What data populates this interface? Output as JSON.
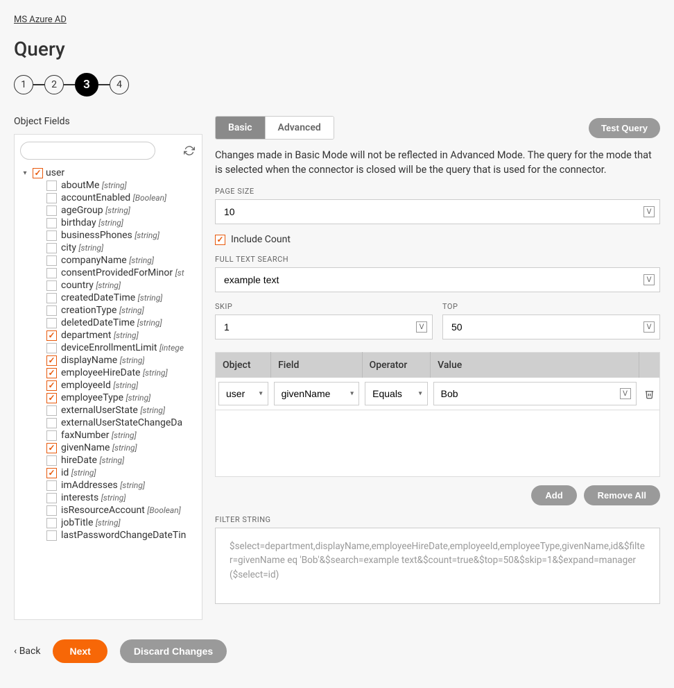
{
  "breadcrumb": "MS Azure AD",
  "page_title": "Query",
  "stepper": {
    "steps": [
      "1",
      "2",
      "3",
      "4"
    ],
    "active_index": 2
  },
  "left": {
    "title": "Object Fields",
    "search_placeholder": "",
    "root": {
      "label": "user",
      "checked": true,
      "expanded": true
    },
    "fields": [
      {
        "name": "aboutMe",
        "type": "[string]",
        "checked": false
      },
      {
        "name": "accountEnabled",
        "type": "[Boolean]",
        "checked": false
      },
      {
        "name": "ageGroup",
        "type": "[string]",
        "checked": false
      },
      {
        "name": "birthday",
        "type": "[string]",
        "checked": false
      },
      {
        "name": "businessPhones",
        "type": "[string]",
        "checked": false
      },
      {
        "name": "city",
        "type": "[string]",
        "checked": false
      },
      {
        "name": "companyName",
        "type": "[string]",
        "checked": false
      },
      {
        "name": "consentProvidedForMinor",
        "type": "[st",
        "checked": false
      },
      {
        "name": "country",
        "type": "[string]",
        "checked": false
      },
      {
        "name": "createdDateTime",
        "type": "[string]",
        "checked": false
      },
      {
        "name": "creationType",
        "type": "[string]",
        "checked": false
      },
      {
        "name": "deletedDateTime",
        "type": "[string]",
        "checked": false
      },
      {
        "name": "department",
        "type": "[string]",
        "checked": true
      },
      {
        "name": "deviceEnrollmentLimit",
        "type": "[intege",
        "checked": false
      },
      {
        "name": "displayName",
        "type": "[string]",
        "checked": true
      },
      {
        "name": "employeeHireDate",
        "type": "[string]",
        "checked": true
      },
      {
        "name": "employeeId",
        "type": "[string]",
        "checked": true
      },
      {
        "name": "employeeType",
        "type": "[string]",
        "checked": true
      },
      {
        "name": "externalUserState",
        "type": "[string]",
        "checked": false
      },
      {
        "name": "externalUserStateChangeDa",
        "type": "",
        "checked": false
      },
      {
        "name": "faxNumber",
        "type": "[string]",
        "checked": false
      },
      {
        "name": "givenName",
        "type": "[string]",
        "checked": true
      },
      {
        "name": "hireDate",
        "type": "[string]",
        "checked": false
      },
      {
        "name": "id",
        "type": "[string]",
        "checked": true
      },
      {
        "name": "imAddresses",
        "type": "[string]",
        "checked": false
      },
      {
        "name": "interests",
        "type": "[string]",
        "checked": false
      },
      {
        "name": "isResourceAccount",
        "type": "[Boolean]",
        "checked": false
      },
      {
        "name": "jobTitle",
        "type": "[string]",
        "checked": false
      },
      {
        "name": "lastPasswordChangeDateTin",
        "type": "",
        "checked": false
      }
    ]
  },
  "right": {
    "tabs": {
      "basic": "Basic",
      "advanced": "Advanced",
      "active": "basic"
    },
    "test_query": "Test Query",
    "info": "Changes made in Basic Mode will not be reflected in Advanced Mode. The query for the mode that is selected when the connector is closed will be the query that is used for the connector.",
    "page_size": {
      "label": "PAGE SIZE",
      "value": "10"
    },
    "include_count": {
      "label": "Include Count",
      "checked": true
    },
    "full_text": {
      "label": "FULL TEXT SEARCH",
      "value": "example text"
    },
    "skip": {
      "label": "SKIP",
      "value": "1"
    },
    "top": {
      "label": "TOP",
      "value": "50"
    },
    "filter_cols": {
      "object": "Object",
      "field": "Field",
      "operator": "Operator",
      "value": "Value"
    },
    "filter_row": {
      "object": "user",
      "field": "givenName",
      "operator": "Equals",
      "value": "Bob"
    },
    "add_btn": "Add",
    "remove_all_btn": "Remove All",
    "filter_string_label": "FILTER STRING",
    "filter_string": "$select=department,displayName,employeeHireDate,employeeId,employeeType,givenName,id&$filter=givenName eq 'Bob'&$search=example text&$count=true&$top=50&$skip=1&$expand=manager($select=id)"
  },
  "footer": {
    "back": "Back",
    "next": "Next",
    "discard": "Discard Changes"
  }
}
